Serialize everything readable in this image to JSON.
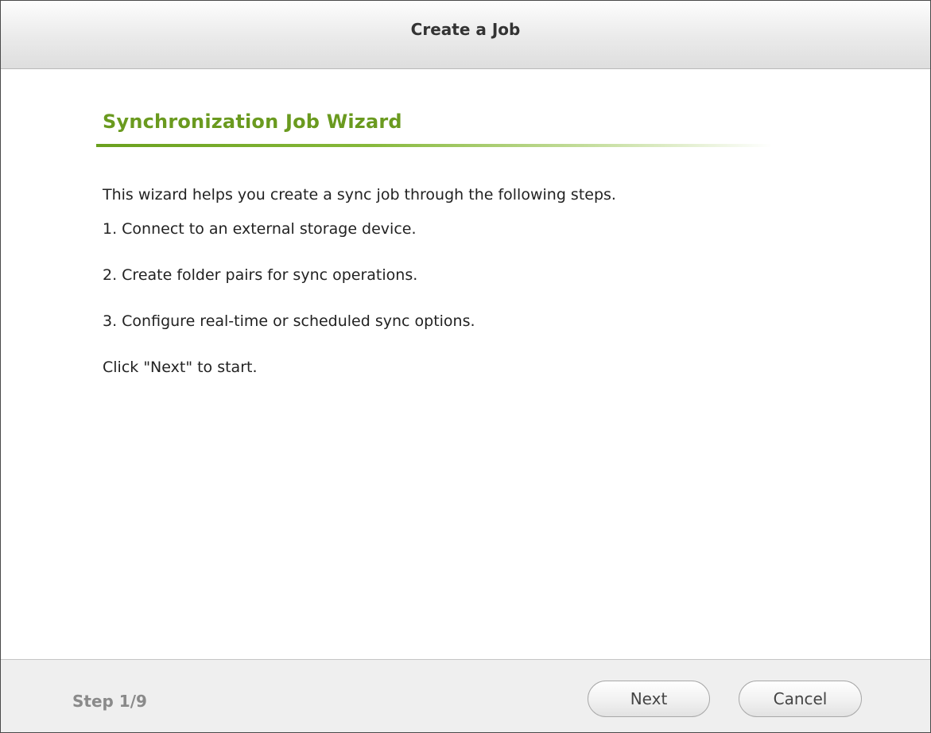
{
  "dialog": {
    "title": "Create a Job"
  },
  "wizard": {
    "heading": "Synchronization Job Wizard",
    "intro": "This wizard helps you create a sync job through the following steps.",
    "steps": [
      "1. Connect to an external storage device.",
      "2. Create folder pairs for sync operations.",
      "3. Configure real-time or scheduled sync options."
    ],
    "instruction": "Click \"Next\" to start."
  },
  "footer": {
    "step_indicator": "Step 1/9",
    "next_label": "Next",
    "cancel_label": "Cancel"
  },
  "colors": {
    "heading_green": "#6a9a1f",
    "titlebar_bg": "#e6e6e6",
    "footer_bg": "#efefef"
  }
}
